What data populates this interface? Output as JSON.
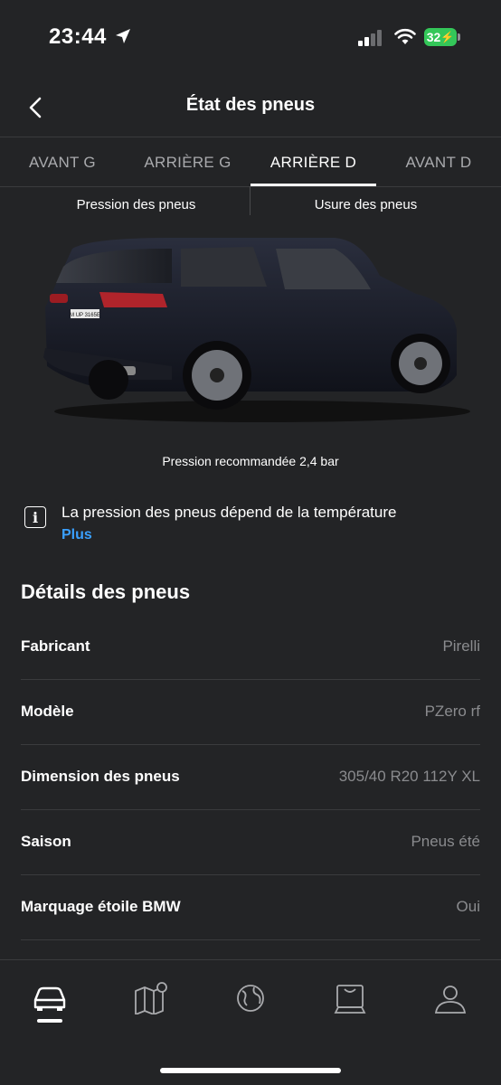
{
  "status": {
    "time": "23:44",
    "battery": "32"
  },
  "header": {
    "title": "État des pneus"
  },
  "tabs": [
    {
      "label": "AVANT G",
      "active": false
    },
    {
      "label": "ARRIÈRE G",
      "active": false
    },
    {
      "label": "ARRIÈRE D",
      "active": true
    },
    {
      "label": "AVANT D",
      "active": false
    }
  ],
  "subtabs": [
    {
      "label": "Pression des pneus"
    },
    {
      "label": "Usure des pneus"
    }
  ],
  "vehicle": {
    "plate": "M UP 3165E"
  },
  "pressure": {
    "recommended": "Pression recommandée 2,4 bar"
  },
  "info": {
    "text": "La pression des pneus dépend de la température",
    "link": "Plus"
  },
  "details": {
    "title": "Détails des pneus",
    "rows": [
      {
        "label": "Fabricant",
        "value": "Pirelli"
      },
      {
        "label": "Modèle",
        "value": "PZero rf"
      },
      {
        "label": "Dimension des pneus",
        "value": "305/40 R20 112Y XL"
      },
      {
        "label": "Saison",
        "value": "Pneus été"
      },
      {
        "label": "Marquage étoile BMW",
        "value": "Oui"
      }
    ]
  },
  "nav": {
    "items": [
      "car-icon",
      "map-icon",
      "globe-icon",
      "shop-icon",
      "profile-icon"
    ],
    "active": "car-icon"
  },
  "colors": {
    "background": "#232426",
    "accent": "#3aa0ff",
    "muted": "#8a8b8e",
    "battery": "#34c759"
  }
}
